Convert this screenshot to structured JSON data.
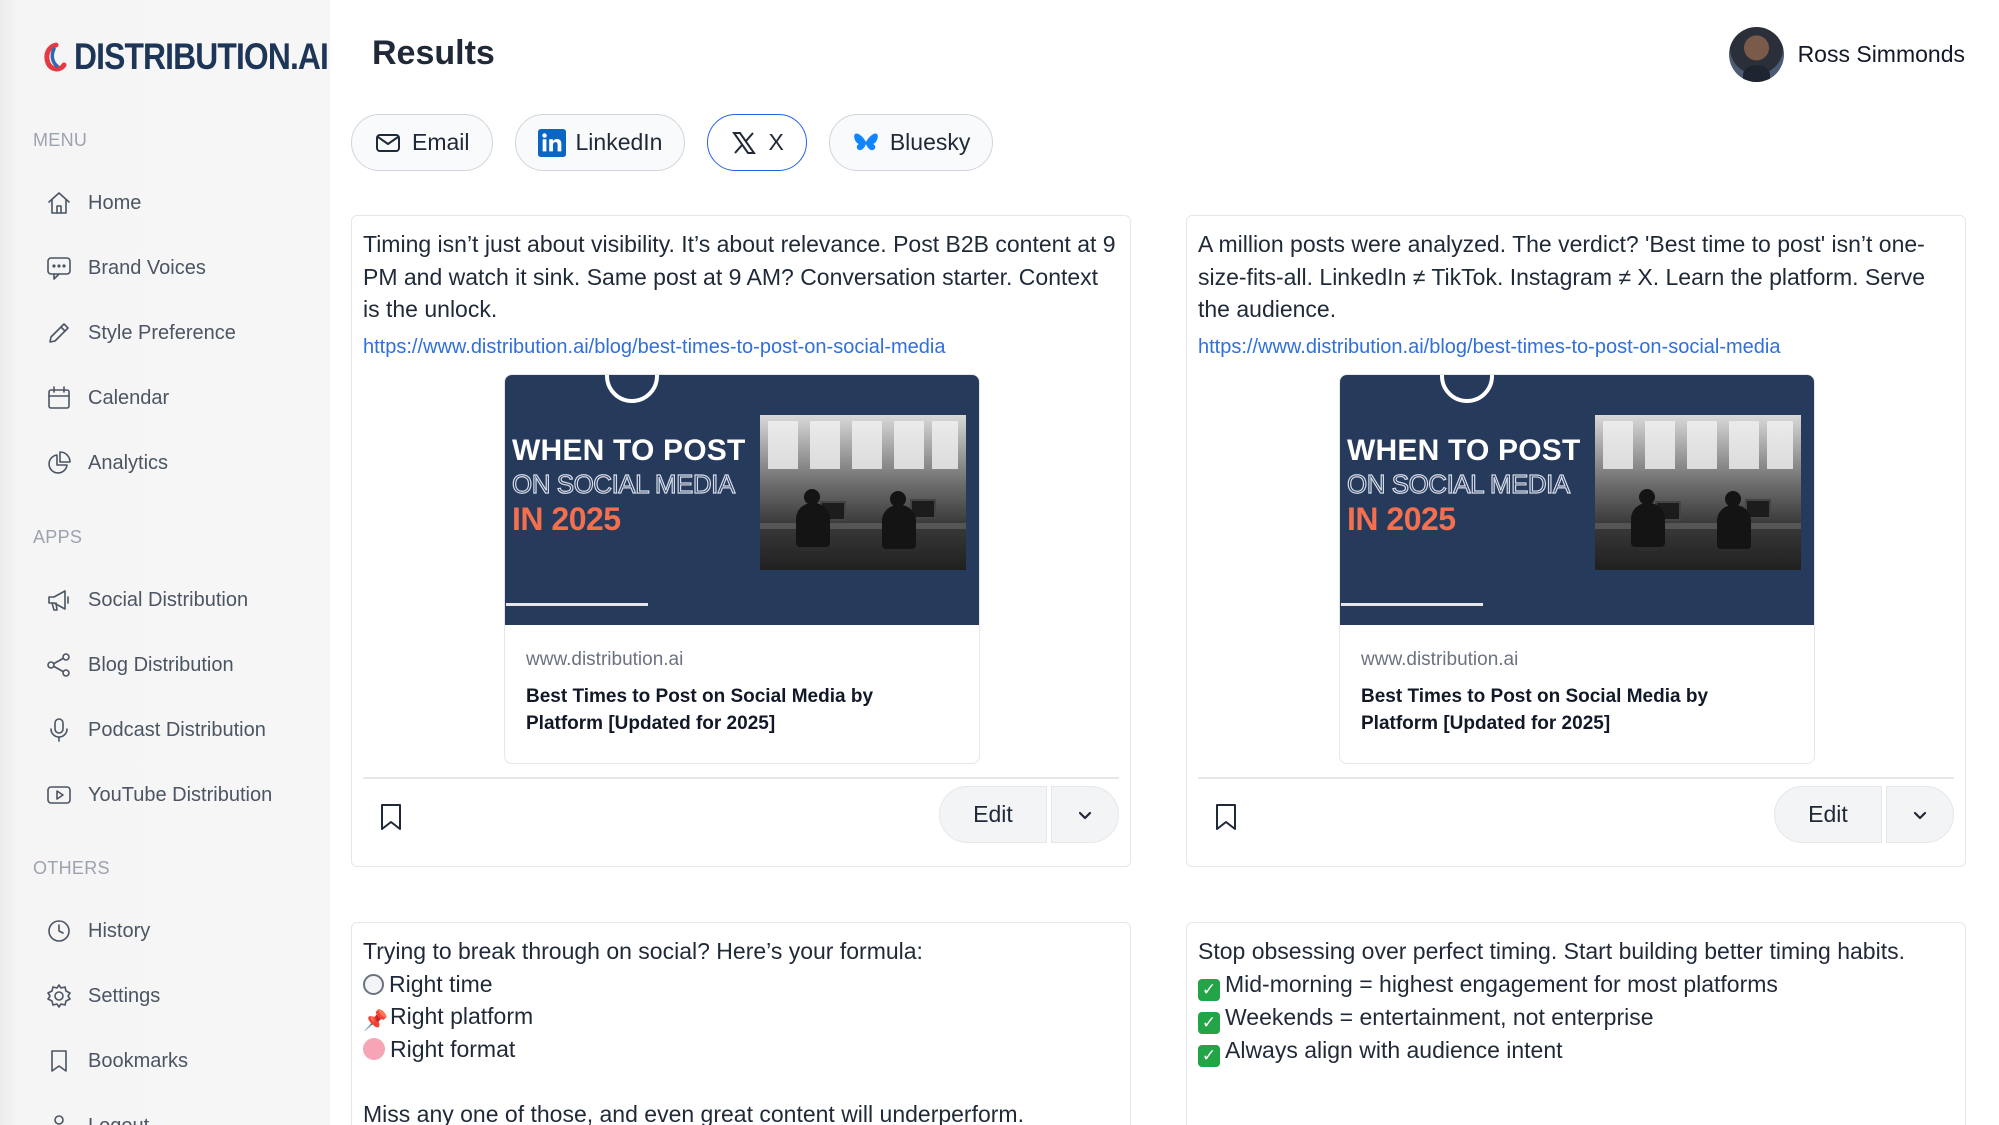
{
  "brand": {
    "name": "DISTRIBUTION.AI"
  },
  "header": {
    "title": "Results"
  },
  "user": {
    "name": "Ross Simmonds"
  },
  "sidebar": {
    "sections": {
      "menu": "MENU",
      "apps": "APPS",
      "others": "OTHERS"
    },
    "menu_items": [
      {
        "label": "Home",
        "icon": "home-icon"
      },
      {
        "label": "Brand Voices",
        "icon": "chat-icon"
      },
      {
        "label": "Style Preference",
        "icon": "pencil-icon"
      },
      {
        "label": "Calendar",
        "icon": "calendar-icon"
      },
      {
        "label": "Analytics",
        "icon": "pie-chart-icon"
      }
    ],
    "apps_items": [
      {
        "label": "Social Distribution",
        "icon": "megaphone-icon"
      },
      {
        "label": "Blog Distribution",
        "icon": "share-icon"
      },
      {
        "label": "Podcast Distribution",
        "icon": "microphone-icon"
      },
      {
        "label": "YouTube Distribution",
        "icon": "play-icon"
      }
    ],
    "others_items": [
      {
        "label": "History",
        "icon": "clock-icon"
      },
      {
        "label": "Settings",
        "icon": "gear-icon"
      },
      {
        "label": "Bookmarks",
        "icon": "bookmark-icon"
      },
      {
        "label": "Logout",
        "icon": "logout-icon"
      }
    ]
  },
  "tabs": [
    {
      "label": "Email",
      "icon": "mail-icon",
      "active": false
    },
    {
      "label": "LinkedIn",
      "icon": "linkedin-icon",
      "active": false
    },
    {
      "label": "X",
      "icon": "x-icon",
      "active": true
    },
    {
      "label": "Bluesky",
      "icon": "butterfly-icon",
      "active": false
    }
  ],
  "colors": {
    "accent": "#2563eb",
    "link": "#2f6fde",
    "brand_navy": "#1d3557",
    "preview_bg": "#263a5c",
    "preview_orange": "#f36f4e"
  },
  "preview": {
    "image_line1": "WHEN TO POST",
    "image_line2": "ON SOCIAL MEDIA",
    "image_line3": "IN 2025",
    "domain": "www.distribution.ai",
    "title": "Best Times to Post on Social Media by Platform [Updated for 2025]"
  },
  "posts": [
    {
      "text": "Timing isn’t just about visibility. It’s about relevance. Post B2B content at 9 PM and watch it sink. Same post at 9 AM? Conversation starter. Context is the unlock.",
      "link": "https://www.distribution.ai/blog/best-times-to-post-on-social-media",
      "edit_label": "Edit"
    },
    {
      "text": "A million posts were analyzed. The verdict? 'Best time to post' isn’t one-size-fits-all. LinkedIn ≠ TikTok. Instagram ≠ X. Learn the platform. Serve the audience.",
      "link": "https://www.distribution.ai/blog/best-times-to-post-on-social-media",
      "edit_label": "Edit"
    },
    {
      "intro": "Trying to break through on social? Here’s your formula:",
      "lines": [
        "Right time",
        "Right platform",
        "Right format"
      ],
      "outro": "Miss any one of those, and even great content will underperform."
    },
    {
      "intro": "Stop obsessing over perfect timing. Start building better timing habits.",
      "lines": [
        "Mid-morning = highest engagement for most platforms",
        "Weekends = entertainment, not enterprise",
        "Always align with audience intent"
      ]
    }
  ]
}
